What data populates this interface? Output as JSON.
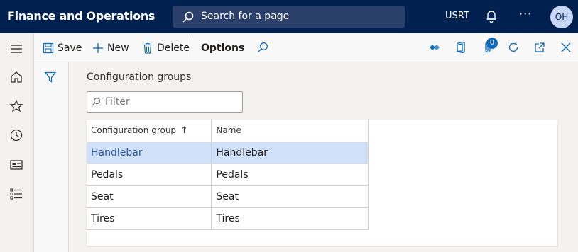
{
  "header": {
    "app_title": "Finance and Operations",
    "search_label": "Search for a page",
    "company": "USRT",
    "more_label": "···",
    "avatar_initials": "OH",
    "background_color": "#002050"
  },
  "actions": {
    "save": "Save",
    "new": "New",
    "delete": "Delete",
    "options": "Options",
    "attachments_count": "0"
  },
  "nav": {
    "items": [
      "home-icon",
      "star-icon",
      "clock-icon",
      "workspace-icon",
      "list-icon"
    ]
  },
  "page": {
    "title": "Configuration groups",
    "filter_placeholder": "Filter"
  },
  "grid": {
    "columns": [
      "Configuration group",
      "Name"
    ],
    "sort_indicator": "↑",
    "rows": [
      {
        "group": "Handlebar",
        "name": "Handlebar",
        "selected": true
      },
      {
        "group": "Pedals",
        "name": "Pedals",
        "selected": false
      },
      {
        "group": "Seat",
        "name": "Seat",
        "selected": false
      },
      {
        "group": "Tires",
        "name": "Tires",
        "selected": false
      }
    ]
  },
  "colors": {
    "accent": "#0f6cbd",
    "selected_row": "#cfe0f8"
  }
}
